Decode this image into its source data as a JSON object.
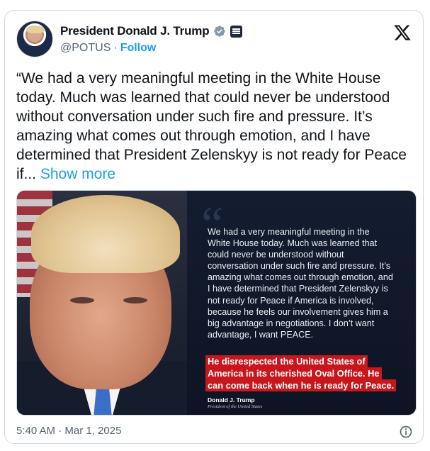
{
  "author": {
    "display_name": "President Donald J. Trump",
    "handle": "@POTUS",
    "separator": "·",
    "follow_label": "Follow"
  },
  "tweet": {
    "text": "“We had a very meaningful meeting in the White House today. Much was learned that could never be understood without conversation under such fire and pressure. It’s amazing what comes out through emotion, and I have determined that President Zelenskyy is not ready for Peace if...",
    "show_more_label": "Show more",
    "timestamp": "5:40 AM · Mar 1, 2025"
  },
  "media": {
    "quote_text": "We had a very meaningful meeting in the White House today. Much was learned that could never be understood without conversation under such fire and pressure. It’s amazing what comes out through emotion, and I have determined that President Zelenskyy is not ready for Peace if America is involved, because he feels our involvement gives him a big advantage in negotiations. I don’t want advantage, I want PEACE.",
    "highlight_lines": [
      "He disrespected the United States of",
      "America in its cherished Oval Office. He",
      "can come back when he is ready for Peace."
    ],
    "signature_name": "Donald J. Trump",
    "signature_title": "President of the United States"
  },
  "icons": {
    "verified": "verified-badge-icon",
    "government": "government-badge-icon",
    "logo": "x-logo-icon",
    "info": "info-icon"
  },
  "colors": {
    "accent": "#1d9bf0",
    "secondary_text": "#536471",
    "highlight_red": "#c8161d"
  }
}
